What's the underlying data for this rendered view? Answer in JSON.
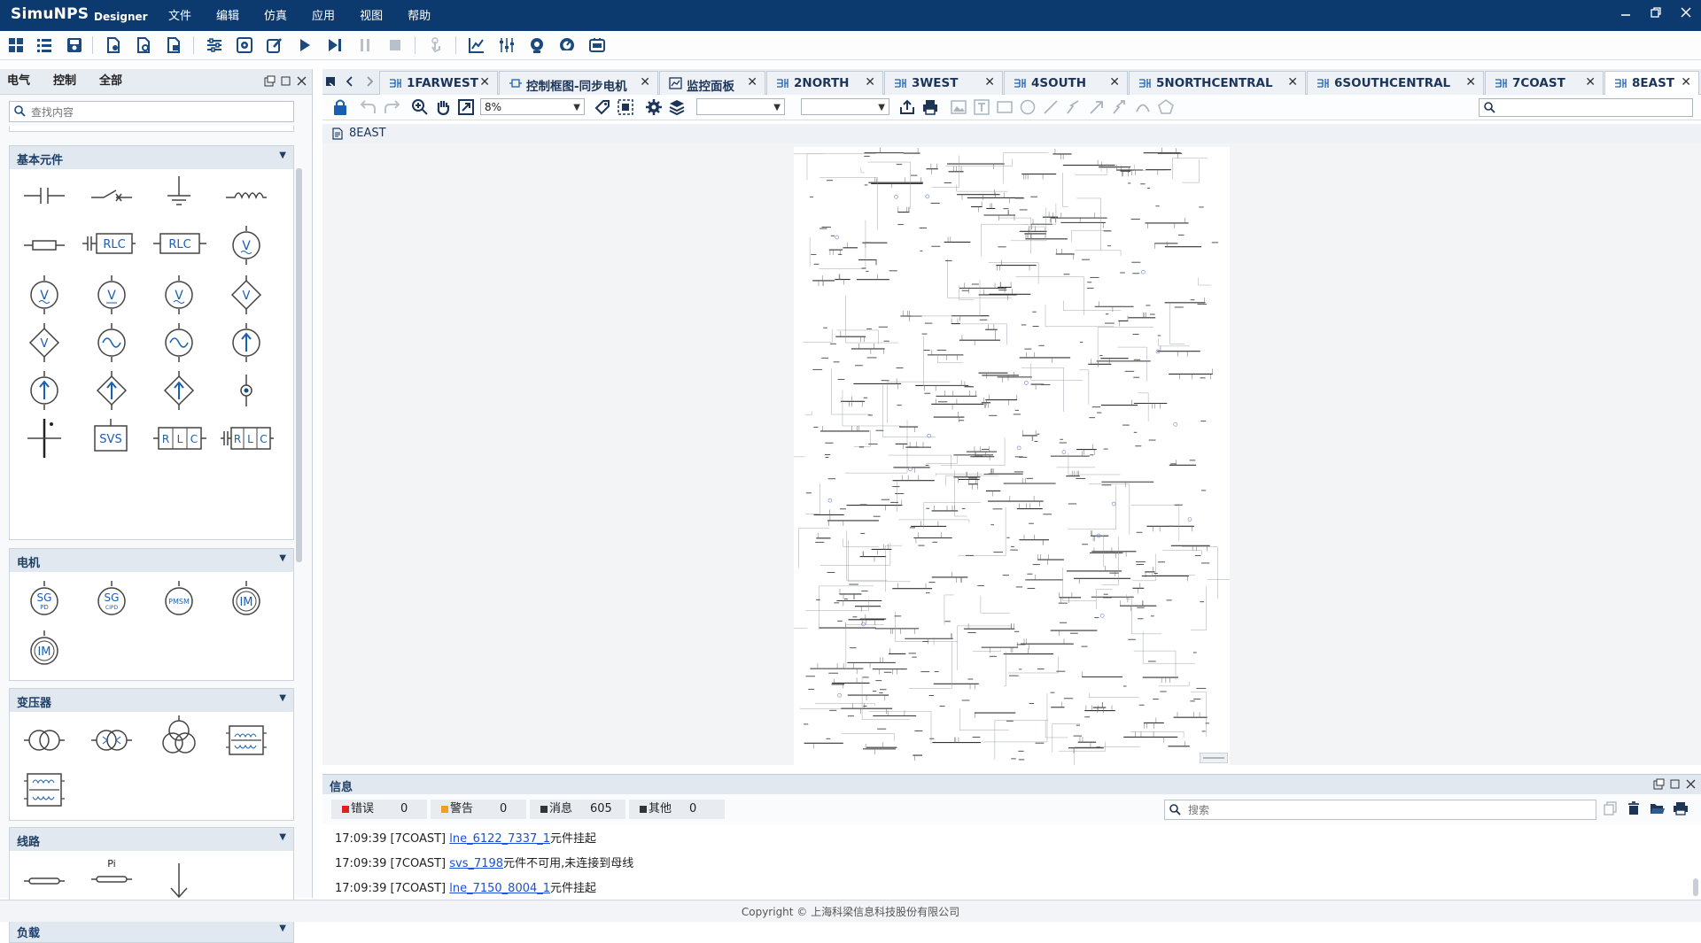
{
  "app": {
    "name": "SimuNPS",
    "edition": "Designer",
    "menu": [
      "文件",
      "编辑",
      "仿真",
      "应用",
      "视图",
      "帮助"
    ]
  },
  "window_controls": [
    "minimize",
    "restore",
    "close"
  ],
  "toolbar_icons": [
    "grid-icon",
    "list-icon",
    "save-icon",
    "new-doc-icon",
    "doc-settings-icon",
    "doc-refresh-icon",
    "tree-icon",
    "gear-square-icon",
    "edit-icon",
    "play-icon",
    "step-icon",
    "pause-icon",
    "stop-icon",
    "touch-icon",
    "chart-icon",
    "mixer-icon",
    "monitor-icon",
    "gauge-icon",
    "device-icon"
  ],
  "left_panel": {
    "tabs": [
      "电气",
      "控制",
      "全部"
    ],
    "search_placeholder": "查找内容",
    "sections": [
      {
        "title": "基本元件",
        "items": [
          "capacitor",
          "breaker",
          "ground",
          "inductor",
          "resistor",
          "rlc-series",
          "rlc-block",
          "voltage-source",
          "voltage-source-2",
          "voltage-source-3",
          "voltage-source-4",
          "controlled-voltage",
          "controlled-voltage-2",
          "ac-source",
          "ac-source-2",
          "current-source",
          "current-source-2",
          "controlled-current",
          "controlled-current-2",
          "node",
          "bus",
          "svs",
          "rlc-parallel",
          "rlc-parallel-2"
        ],
        "labels": {
          "rlc": "RLC",
          "svs": "SVS",
          "rlc_split": [
            "R",
            "L",
            "C"
          ]
        }
      },
      {
        "title": "电机",
        "items": [
          "sg-pd",
          "sg-cipd",
          "pmsm",
          "im",
          "im-2"
        ],
        "labels": {
          "sg": "SG",
          "pd": "PD",
          "cipd": "CIPD",
          "pmsm": "PMSM",
          "im": "IM"
        }
      },
      {
        "title": "变压器",
        "items": [
          "transformer-2w",
          "transformer-2w-b",
          "transformer-3w",
          "transformer-core",
          "transformer-core-2"
        ]
      },
      {
        "title": "线路",
        "items": [
          "line",
          "pi-line",
          "ground-arrow"
        ],
        "labels": {
          "pi": "Pi"
        }
      },
      {
        "title": "负载",
        "items": []
      }
    ]
  },
  "doc_tabs": [
    {
      "label": "1FARWEST",
      "active": false
    },
    {
      "label": "控制框图-同步电机",
      "active": false
    },
    {
      "label": "监控面板",
      "active": false
    },
    {
      "label": "2NORTH",
      "active": false
    },
    {
      "label": "3WEST",
      "active": false
    },
    {
      "label": "4SOUTH",
      "active": false
    },
    {
      "label": "5NORTHCENTRAL",
      "active": false
    },
    {
      "label": "6SOUTHCENTRAL",
      "active": false
    },
    {
      "label": "7COAST",
      "active": false
    },
    {
      "label": "8EAST",
      "active": true
    }
  ],
  "editor_toolbar": {
    "zoom": "8%",
    "combo1": "",
    "combo2": "",
    "search_value": ""
  },
  "breadcrumb": "8EAST",
  "info_panel": {
    "title": "信息",
    "counters": [
      {
        "label": "错误",
        "count": "0",
        "color": "#e02020"
      },
      {
        "label": "警告",
        "count": "0",
        "color": "#f0a020"
      },
      {
        "label": "消息",
        "count": "605",
        "color": "#333333"
      },
      {
        "label": "其他",
        "count": "0",
        "color": "#333333"
      }
    ],
    "search_placeholder": "搜索",
    "logs": [
      {
        "prefix": "17:09:39 [7COAST] ",
        "link": "lne_6122_7337_1",
        "suffix": "元件挂起"
      },
      {
        "prefix": "17:09:39 [7COAST] ",
        "link": "svs_7198",
        "suffix": "元件不可用,未连接到母线"
      },
      {
        "prefix": "17:09:39 [7COAST] ",
        "link": "lne_7150_8004_1",
        "suffix": "元件挂起"
      }
    ]
  },
  "footer": "Copyright © 上海科梁信息科技股份有限公司",
  "colors": {
    "titlebar": "#0c3a6e",
    "accent": "#1a5fb4",
    "icon": "#1a4a80"
  }
}
